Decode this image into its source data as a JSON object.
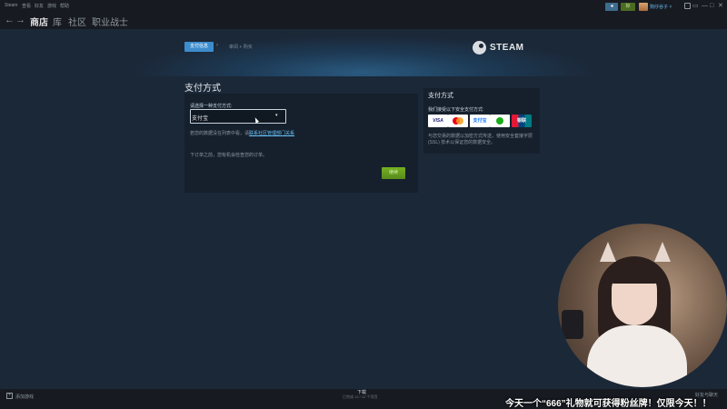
{
  "window": {
    "menu": [
      "Steam",
      "查看",
      "好友",
      "游戏",
      "帮助"
    ],
    "badge_blue": "◂",
    "badge_green": "好",
    "username": "狗仔谷子 ˅",
    "controls": [
      "▭",
      "—",
      "□",
      "✕"
    ]
  },
  "nav": {
    "back": "←",
    "forward": "→",
    "store": "商店",
    "library": "库",
    "community": "社区",
    "profile": "职业战士"
  },
  "checkout": {
    "step_active": "支付信息",
    "step_arrow": "›",
    "step_next": "审阅 + 购买",
    "logo_text": "STEAM"
  },
  "payment": {
    "section_title": "支付方式",
    "select_prompt": "请选择一种支付方式:",
    "selected_method": "支付宝",
    "caret": "▾",
    "help_text": "若您的数据没在列表中看，请",
    "help_link": "联系社区管理部门关系",
    "review_note": "下订单之前，您有机会检查您的订单。",
    "continue_label": "继续"
  },
  "side": {
    "title": "支付方式",
    "subtitle": "我们接受以下安全支付方式:",
    "cards": {
      "visa": "VISA",
      "alipay": "支付宝",
      "unionpay": "银联"
    },
    "security_note": "与您交易的数据以加密方式传送，使用安全套接字层 (SSL) 技术以保证您的数据安全。"
  },
  "bottom": {
    "add_game_icon": "+",
    "add_game": "添加游戏",
    "downloads": "下载",
    "downloads_status": "已完成 12 / 12 个项目",
    "friends": "好友与聊天"
  },
  "overlay": {
    "ticker": "今天一个“666”礼物就可获得粉丝牌！仅限今天！！"
  }
}
